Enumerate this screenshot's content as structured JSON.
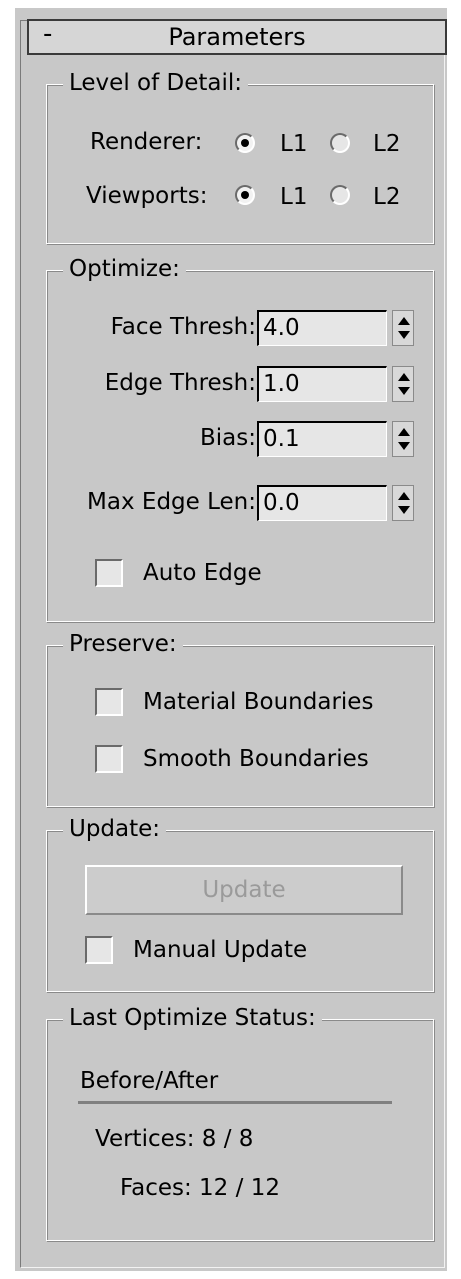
{
  "rollout": {
    "collapse_glyph": "-",
    "title": "Parameters"
  },
  "level_of_detail": {
    "legend": "Level of Detail:",
    "renderer_label": "Renderer:",
    "viewports_label": "Viewports:",
    "option_l1": "L1",
    "option_l2": "L2",
    "renderer_selected": "L1",
    "viewports_selected": "L1"
  },
  "optimize": {
    "legend": "Optimize:",
    "face_thresh_label": "Face Thresh:",
    "face_thresh_value": "4.0",
    "edge_thresh_label": "Edge Thresh:",
    "edge_thresh_value": "1.0",
    "bias_label": "Bias:",
    "bias_value": "0.1",
    "max_edge_len_label": "Max Edge Len:",
    "max_edge_len_value": "0.0",
    "auto_edge_label": "Auto Edge",
    "auto_edge_checked": false
  },
  "preserve": {
    "legend": "Preserve:",
    "material_boundaries_label": "Material Boundaries",
    "material_boundaries_checked": false,
    "smooth_boundaries_label": "Smooth Boundaries",
    "smooth_boundaries_checked": false
  },
  "update": {
    "legend": "Update:",
    "update_button_label": "Update",
    "manual_update_label": "Manual Update",
    "manual_update_checked": false
  },
  "status": {
    "legend": "Last Optimize Status:",
    "header": "Before/After",
    "vertices": "Vertices: 8 / 8",
    "faces": "Faces: 12 / 12"
  },
  "colors": {
    "panel_bg": "#c8c8c8",
    "field_bg": "#e6e6e6",
    "disabled_text": "#9a9a9a"
  }
}
